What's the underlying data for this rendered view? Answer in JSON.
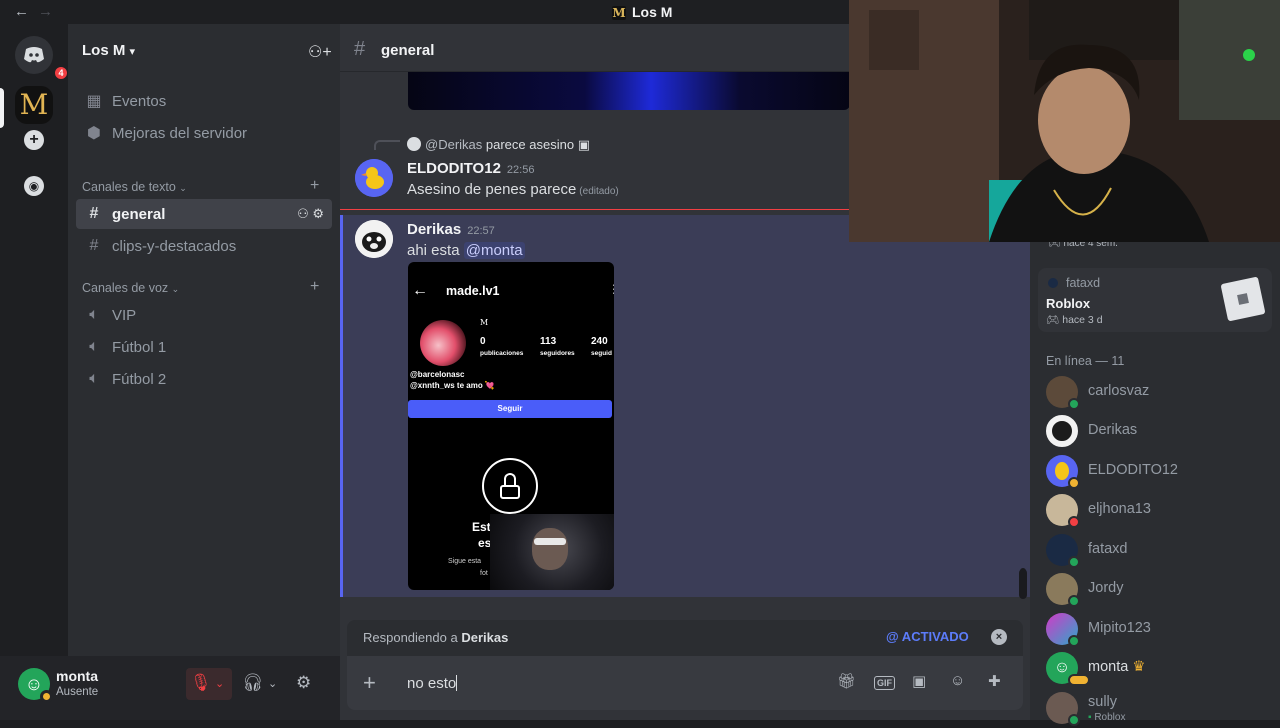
{
  "window": {
    "title": "Los M",
    "back": "←",
    "forward": "→"
  },
  "rail": {
    "dm_badge": "4",
    "server_letter": "M"
  },
  "server": {
    "name": "Los M"
  },
  "channels": {
    "events_label": "Eventos",
    "boosts_label": "Mejoras del servidor",
    "text_category": "Canales de texto",
    "voice_category": "Canales de voz",
    "text": [
      "general",
      "clips-y-destacados"
    ],
    "voice": [
      "VIP",
      "Fútbol 1",
      "Fútbol 2"
    ]
  },
  "user": {
    "name": "monta",
    "status": "Ausente"
  },
  "chat": {
    "channel": "general",
    "reply_ref_user": "@Derikas",
    "reply_ref_text": "parece asesino",
    "messages": [
      {
        "author": "ELDODITO12",
        "time": "22:56",
        "text": "Asesino de penes parece",
        "edited": "(editado)"
      },
      {
        "author": "Derikas",
        "time": "22:57",
        "text": "ahi esta",
        "mention": "@monta"
      }
    ],
    "phone": {
      "username": "made.lv1",
      "name_initial": "M",
      "stats": [
        {
          "value": "0",
          "label": "publicaciones"
        },
        {
          "value": "113",
          "label": "seguidores"
        },
        {
          "value": "240",
          "label": "seguid"
        }
      ],
      "bio_line1": "@barcelonasc",
      "bio_line2": "@xnnth_ws te amo 💘",
      "follow_label": "Seguir",
      "private_text": "Est",
      "private_text2": "es",
      "private_sub": "Sigue esta",
      "private_sub2": "fot"
    }
  },
  "composer": {
    "replying_prefix": "Respondiendo a",
    "replying_to": "Derikas",
    "ping_label": "@ ACTIVADO",
    "input_value": "no esto"
  },
  "members": {
    "activity1_time": "hace 4 sem.",
    "activity2": {
      "user": "fataxd",
      "game": "Roblox",
      "time": "hace 3 d"
    },
    "online_header": "En línea — 11",
    "list": [
      {
        "name": "carlosvaz",
        "status": "online"
      },
      {
        "name": "Derikas",
        "status": "none"
      },
      {
        "name": "ELDODITO12",
        "status": "idle"
      },
      {
        "name": "eljhona13",
        "status": "dnd"
      },
      {
        "name": "fataxd",
        "status": "online"
      },
      {
        "name": "Jordy",
        "status": "online"
      },
      {
        "name": "Mipito123",
        "status": "online"
      },
      {
        "name": "monta",
        "status": "idle"
      },
      {
        "name": "sully",
        "status": "online",
        "sub": "Roblox"
      }
    ]
  },
  "colors": {
    "brand": "#5865f2",
    "online": "#23a55a",
    "idle": "#f0b232",
    "dnd": "#f23f43",
    "mention_bar": "#5865f2"
  }
}
